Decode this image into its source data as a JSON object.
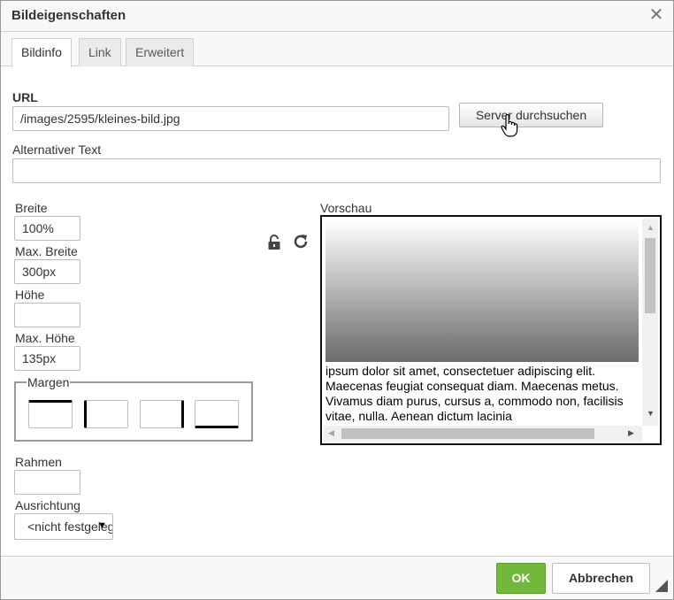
{
  "dialog": {
    "title": "Bildeigenschaften",
    "close_glyph": "✕"
  },
  "tabs": [
    {
      "label": "Bildinfo",
      "active": true
    },
    {
      "label": "Link",
      "active": false
    },
    {
      "label": "Erweitert",
      "active": false
    }
  ],
  "url": {
    "label": "URL",
    "value": "/images/2595/kleines-bild.jpg",
    "browse_label": "Server durchsuchen"
  },
  "alt_text": {
    "label": "Alternativer Text",
    "value": ""
  },
  "width": {
    "label": "Breite",
    "value": "100%"
  },
  "max_width": {
    "label": "Max. Breite",
    "value": "300px"
  },
  "height": {
    "label": "Höhe",
    "value": ""
  },
  "max_height": {
    "label": "Max. Höhe",
    "value": "135px"
  },
  "margins": {
    "label": "Margen",
    "top": "",
    "right": "",
    "bottom": "",
    "left": ""
  },
  "border": {
    "label": "Rahmen",
    "value": ""
  },
  "alignment": {
    "label": "Ausrichtung",
    "value": "<nicht festgelegt>"
  },
  "preview": {
    "label": "Vorschau",
    "text": "ipsum dolor sit amet, consectetuer adipiscing elit. Maecenas feugiat consequat diam. Maecenas metus. Vivamus diam purus, cursus a, commodo non, facilisis vitae, nulla. Aenean dictum lacinia"
  },
  "footer": {
    "ok_label": "OK",
    "cancel_label": "Abbrechen"
  },
  "colors": {
    "ok_button": "#72b83b",
    "panel_background": "#f8f8f8"
  }
}
